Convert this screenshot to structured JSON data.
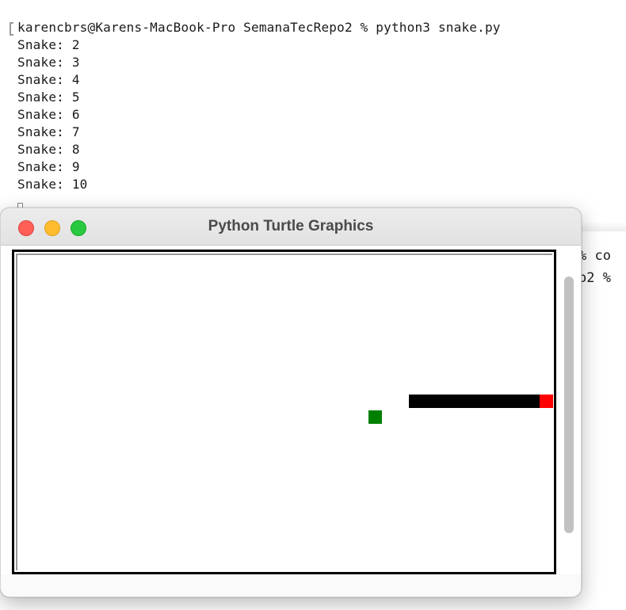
{
  "terminal": {
    "command_line": "karencbrs@Karens-MacBook-Pro SemanaTecRepo2 % python3 snake.py",
    "output_lines": [
      "Snake: 2",
      "Snake: 3",
      "Snake: 4",
      "Snake: 5",
      "Snake: 6",
      "Snake: 7",
      "Snake: 8",
      "Snake: 9",
      "Snake: 10"
    ],
    "peek_lines": [
      "% co",
      "o2 %"
    ]
  },
  "turtle_window": {
    "title": "Python Turtle Graphics",
    "colors": {
      "close": "#ff5f57",
      "minimize": "#febc2e",
      "maximize": "#28c840",
      "food": "#008000",
      "snake_body": "#000000",
      "snake_head": "#ff0000"
    }
  }
}
